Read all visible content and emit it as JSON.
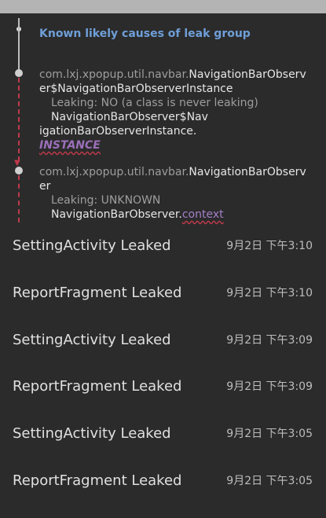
{
  "trace": {
    "title": "Known likely causes of leak group",
    "frame1": {
      "pkg": "com.lxj.xpopup.util.navbar.",
      "cls_line1": "NavigationBarObserv",
      "cls_line2": "er$NavigationBarObserverInstance",
      "leaking": "Leaking: NO (a class is never leaking)",
      "ref_line1": "NavigationBarObserver$Nav",
      "ref_line2": "igationBarObserverInstance.",
      "field": "INSTANCE"
    },
    "frame2": {
      "pkg": "com.lxj.xpopup.util.navbar.",
      "cls_line1": "NavigationBarObserv",
      "cls_line2": "er",
      "leaking": "Leaking: UNKNOWN",
      "ref": "NavigationBarObserver.",
      "field": "context"
    }
  },
  "leaks": [
    {
      "title": "SettingActivity Leaked",
      "time": "9月2日 下午3:10"
    },
    {
      "title": "ReportFragment Leaked",
      "time": "9月2日 下午3:10"
    },
    {
      "title": "SettingActivity Leaked",
      "time": "9月2日 下午3:09"
    },
    {
      "title": "ReportFragment Leaked",
      "time": "9月2日 下午3:09"
    },
    {
      "title": "SettingActivity Leaked",
      "time": "9月2日 下午3:05"
    },
    {
      "title": "ReportFragment Leaked",
      "time": "9月2日 下午3:05"
    }
  ]
}
